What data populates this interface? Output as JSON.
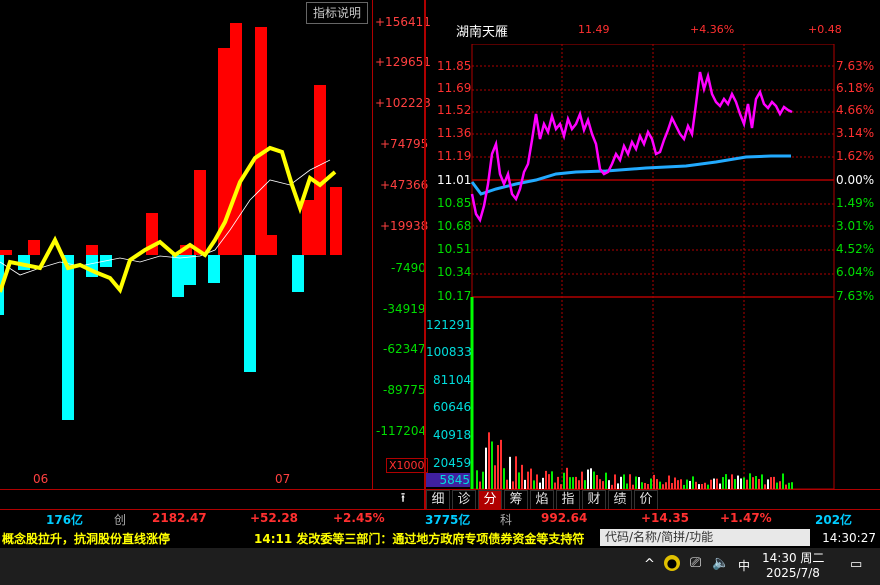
{
  "indicator_label": "指标说明",
  "left_axis": {
    "ticks": [
      "+156411",
      "+129651",
      "+102223",
      "+74795",
      "+47366",
      "+19938",
      "-7490",
      "-34919",
      "-62347",
      "-89775",
      "-117204"
    ],
    "unit": "X1000"
  },
  "left_x_labels": [
    "06",
    "07"
  ],
  "stock": {
    "name": "湖南天雁",
    "price": "11.49",
    "pct": "+4.36%",
    "change": "+0.48"
  },
  "price_axis": [
    "11.85",
    "11.69",
    "11.52",
    "11.36",
    "11.19",
    "11.01",
    "10.85",
    "10.68",
    "10.51",
    "10.34",
    "10.17"
  ],
  "pct_axis": [
    "7.63%",
    "6.18%",
    "4.66%",
    "3.14%",
    "1.62%",
    "0.00%",
    "1.49%",
    "3.01%",
    "4.52%",
    "6.04%",
    "7.63%"
  ],
  "volume_axis": [
    "121291",
    "100833",
    "81104",
    "60646",
    "40918",
    "20459",
    "5845"
  ],
  "tabs": [
    "细",
    "诊",
    "分",
    "筹",
    "焰",
    "指",
    "财",
    "绩",
    "价"
  ],
  "active_tab": "分",
  "index_bar": {
    "amt1": "176亿",
    "idx1_name": "创",
    "idx1_val": "2182.47",
    "idx1_chg": "+52.28",
    "idx1_pct": "+2.45%",
    "amt2": "3775亿",
    "idx2_name": "科",
    "idx2_val": "992.64",
    "idx2_chg": "+14.35",
    "idx2_pct": "+1.47%",
    "amt3": "202亿"
  },
  "news": {
    "left": "概念股拉升，抗洞股份直线涨停",
    "right": "14:11 发改委等三部门：通过地方政府专项债券资金等支持符"
  },
  "search_placeholder": "代码/名称/简拼/功能",
  "clock": "14:30:27",
  "taskbar": {
    "ime": "中",
    "time": "14:30 周二",
    "date": "2025/7/8"
  },
  "colors": {
    "up": "#ff0000",
    "down": "#00ffff",
    "yellow": "#ffff00",
    "magenta": "#ff00ff",
    "avg": "#22aaff",
    "grid": "#b00000"
  }
}
